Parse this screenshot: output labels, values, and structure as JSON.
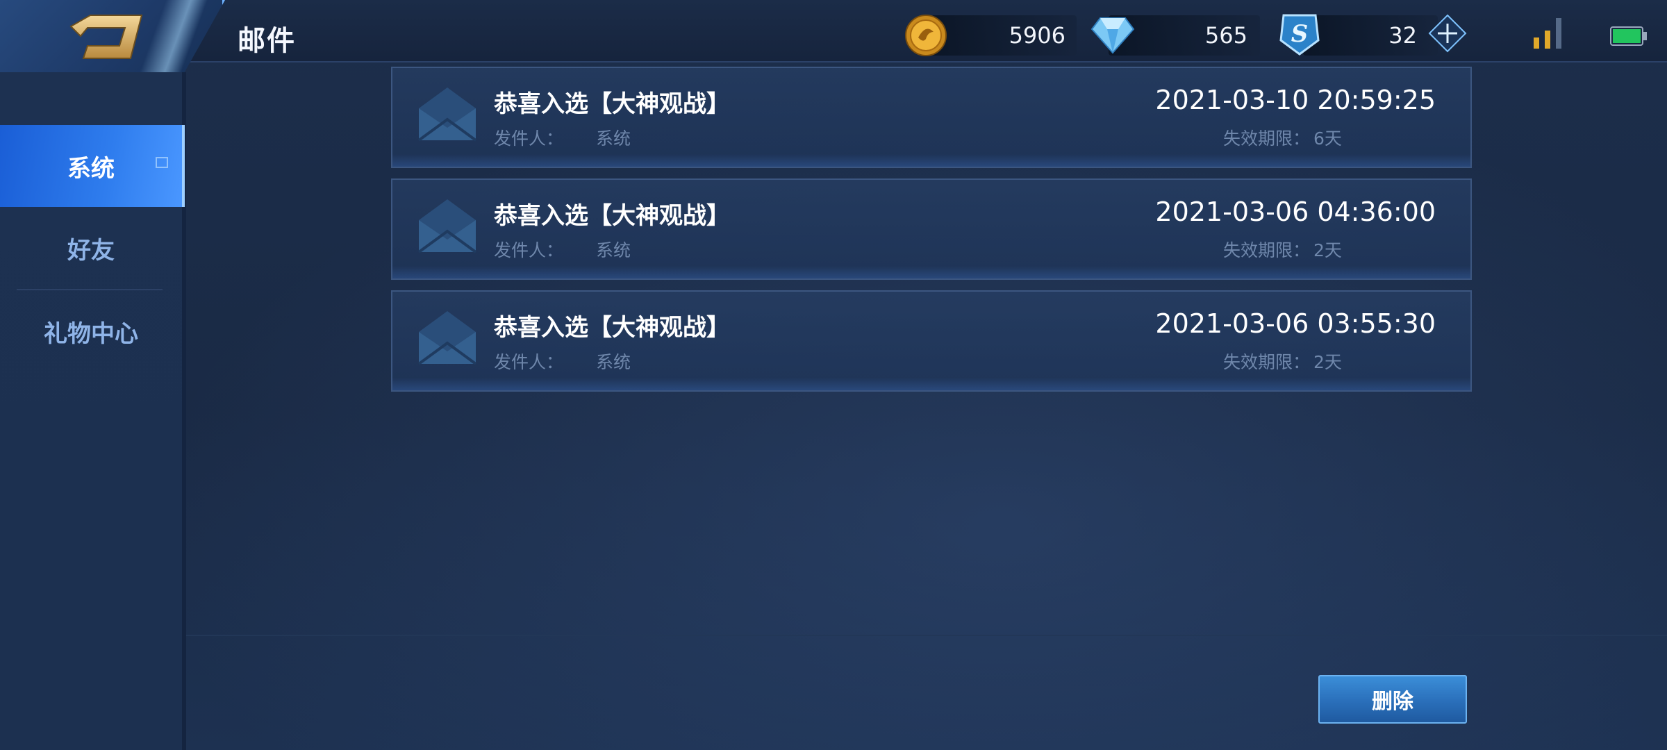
{
  "header": {
    "title": "邮件",
    "back_icon": "back-arrow-icon",
    "gold": {
      "icon": "gold-coin-icon",
      "value": "5906"
    },
    "diamond": {
      "icon": "diamond-icon",
      "value": "565"
    },
    "voucher": {
      "icon": "voucher-s-icon",
      "value": "32"
    },
    "add_icon": "plus-icon",
    "signal_icon": "signal-icon",
    "battery_icon": "battery-icon"
  },
  "sidebar": {
    "items": [
      {
        "label": "系统",
        "active": true
      },
      {
        "label": "好友",
        "active": false
      },
      {
        "label": "礼物中心",
        "active": false
      }
    ]
  },
  "mails": [
    {
      "title": "恭喜入选【大神观战】",
      "sender_label": "发件人：",
      "sender": "系统",
      "date": "2021-03-10 20:59:25",
      "expire_label": "失效期限：",
      "expire": "6天"
    },
    {
      "title": "恭喜入选【大神观战】",
      "sender_label": "发件人：",
      "sender": "系统",
      "date": "2021-03-06 04:36:00",
      "expire_label": "失效期限：",
      "expire": "2天"
    },
    {
      "title": "恭喜入选【大神观战】",
      "sender_label": "发件人：",
      "sender": "系统",
      "date": "2021-03-06 03:55:30",
      "expire_label": "失效期限：",
      "expire": "2天"
    }
  ],
  "actions": {
    "delete_label": "删除"
  },
  "colors": {
    "accent": "#2f7dee",
    "gold": "#e0a82a",
    "diamond": "#7cc9f5",
    "battery": "#22c55e"
  }
}
